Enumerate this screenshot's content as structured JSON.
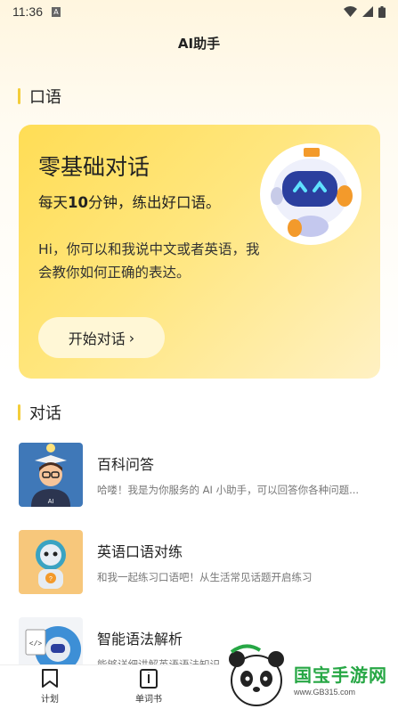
{
  "status_bar": {
    "time": "11:36",
    "notification_icon": "A"
  },
  "header": {
    "title": "AI助手"
  },
  "sections": {
    "oral": "口语",
    "dialogue": "对话"
  },
  "hero": {
    "title": "零基础对话",
    "subtitle_pre": "每天",
    "subtitle_num": "10",
    "subtitle_post": "分钟，练出好口语。",
    "description": "Hi，你可以和我说中文或者英语，我会教你如何正确的表达。",
    "button_label": "开始对话",
    "button_arrow": "›"
  },
  "list": [
    {
      "name": "百科问答",
      "desc": "哈喽！我是为你服务的 AI 小助手，可以回答你各种问题..."
    },
    {
      "name": "英语口语对练",
      "desc": "和我一起练习口语吧！从生活常见话题开启练习"
    },
    {
      "name": "智能语法解析",
      "desc": "能够详细讲解英语语法知识"
    }
  ],
  "bottom_nav": {
    "plan": "计划",
    "wordbook": "单词书"
  },
  "watermark": {
    "title": "国宝手游网",
    "url": "www.GB315.com"
  },
  "colors": {
    "accent": "#f4cd3a",
    "hero_bg": "#ffdd55",
    "watermark_green": "#27a745"
  }
}
